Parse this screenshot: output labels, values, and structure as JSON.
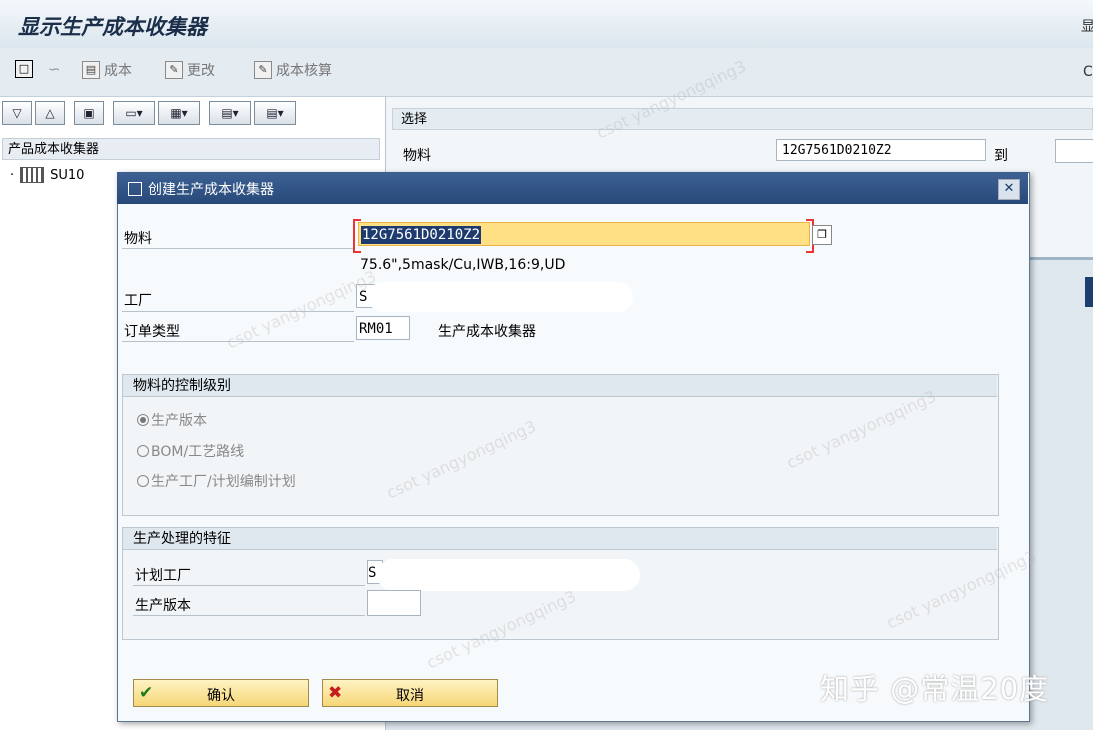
{
  "window": {
    "title": "显示生产成本收集器",
    "edge_char_top": "显",
    "edge_char_mid": "C"
  },
  "toolbar": {
    "cost_label": "成本",
    "change_label": "更改",
    "cost_estimate_label": "成本核算"
  },
  "left_panel": {
    "tree_header": "产品成本收集器",
    "tree_node": "SU10"
  },
  "selection": {
    "header": "选择",
    "material_label": "物料",
    "material_value": "12G7561D0210Z2",
    "to_label": "到"
  },
  "dialog": {
    "title": "创建生产成本收集器",
    "close": "✕",
    "material_label": "物料",
    "material_value": "12G7561D0210Z2",
    "material_desc": "75.6\",5mask/Cu,IWB,16:9,UD",
    "plant_label": "工厂",
    "plant_value": "S",
    "order_type_label": "订单类型",
    "order_type_value": "RM01",
    "order_type_desc": "生产成本收集器",
    "control_group": {
      "title": "物料的控制级别",
      "options": [
        "生产版本",
        "BOM/工艺路线",
        "生产工厂/计划编制计划"
      ],
      "selected_index": 0
    },
    "process_group": {
      "title": "生产处理的特征",
      "planning_plant_label": "计划工厂",
      "planning_plant_value": "S",
      "version_label": "生产版本",
      "version_value": ""
    },
    "confirm_label": "确认",
    "cancel_label": "取消"
  },
  "watermark": {
    "author": "知乎 @常温20度",
    "tile": "csot yangyongqing3"
  },
  "icons": [
    "new-doc-icon",
    "glasses-icon",
    "cost-icon",
    "change-icon",
    "cost-estimate-icon",
    "expand-icon",
    "collapse-icon",
    "find-icon",
    "print-icon",
    "grid-icon",
    "export-icon",
    "layout-icon",
    "plant-icon",
    "help-icon",
    "check-icon",
    "cancel-x-icon"
  ]
}
